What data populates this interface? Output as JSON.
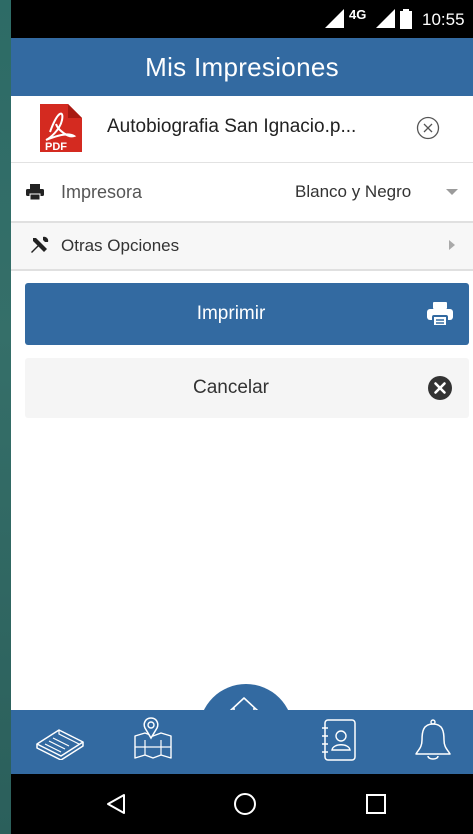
{
  "status_bar": {
    "network": "4G",
    "time": "10:55"
  },
  "header": {
    "title": "Mis Impresiones"
  },
  "file": {
    "icon_text": "PDF",
    "name": "Autobiografia San Ignacio.p..."
  },
  "printer": {
    "label": "Impresora",
    "selected": "Blanco y Negro"
  },
  "options": {
    "label": "Otras Opciones"
  },
  "actions": {
    "print_label": "Imprimir",
    "cancel_label": "Cancelar"
  },
  "colors": {
    "primary": "#336aa1",
    "pdf_red": "#d42a20"
  },
  "bottom_nav": {
    "items": [
      "book-icon",
      "map-icon",
      "home-icon",
      "contacts-icon",
      "bell-icon"
    ]
  },
  "system_nav": {
    "items": [
      "back-icon",
      "home-circle-icon",
      "recents-icon"
    ]
  }
}
